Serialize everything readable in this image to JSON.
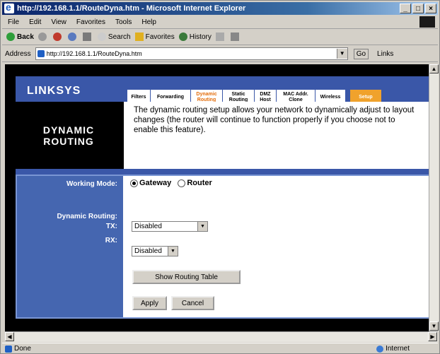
{
  "window": {
    "title": "http://192.168.1.1/RouteDyna.htm - Microsoft Internet Explorer"
  },
  "menu": [
    "File",
    "Edit",
    "View",
    "Favorites",
    "Tools",
    "Help"
  ],
  "toolbar": {
    "back": "Back",
    "search": "Search",
    "favorites": "Favorites",
    "history": "History"
  },
  "address": {
    "label": "Address",
    "url": "http://192.168.1.1/RouteDyna.htm",
    "go": "Go",
    "links": "Links"
  },
  "page": {
    "brand": "LINKSYS",
    "tabs": [
      {
        "label": "Filters"
      },
      {
        "label": "Forwarding"
      },
      {
        "label": "Dynamic Routing"
      },
      {
        "label": "Static Routing"
      },
      {
        "label": "DMZ Host"
      },
      {
        "label": "MAC Addr. Clone"
      },
      {
        "label": "Wireless"
      },
      {
        "label": "Setup"
      }
    ],
    "section_title_1": "DYNAMIC",
    "section_title_2": "ROUTING",
    "description": "The dynamic routing setup allows your network to dynamically adjust to layout changes (the router will continue to function properly if you choose not to enable this feature).",
    "working_mode_label": "Working Mode:",
    "working_mode_options": [
      "Gateway",
      "Router"
    ],
    "dynamic_routing_label": "Dynamic Routing:",
    "tx_label": "TX:",
    "rx_label": "RX:",
    "tx_value": "Disabled",
    "rx_value": "Disabled",
    "show_table_button": "Show Routing Table",
    "apply_button": "Apply",
    "cancel_button": "Cancel"
  },
  "status": {
    "left": "Done",
    "zone": "Internet"
  }
}
